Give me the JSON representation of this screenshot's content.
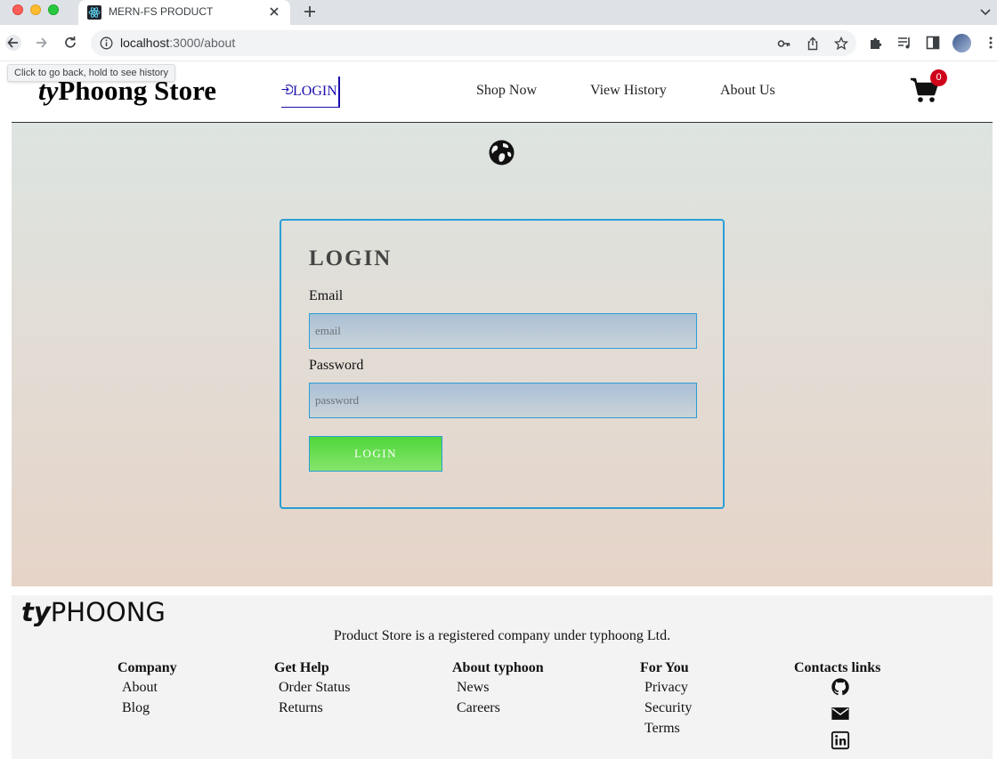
{
  "browser": {
    "tab_title": "MERN-FS PRODUCT",
    "url_host": "localhost",
    "url_path": ":3000/about",
    "tooltip": "Click to go back, hold to see history"
  },
  "header": {
    "brand_prefix": "ty",
    "brand_rest": "Phoong Store",
    "login_label": "LOGIN",
    "nav": [
      "Shop Now",
      "View History",
      "About Us"
    ],
    "cart_count": "0"
  },
  "login_form": {
    "title": "LOGIN",
    "email_label": "Email",
    "email_placeholder": "email",
    "email_value": "",
    "password_label": "Password",
    "password_placeholder": "password",
    "password_value": "",
    "submit_label": "LOGIN"
  },
  "footer": {
    "logo_prefix": "ty",
    "logo_rest": "PHOONG",
    "tagline": "Product Store is a registered company under typhoong Ltd.",
    "columns": [
      {
        "title": "Company",
        "links": [
          "About",
          "Blog"
        ]
      },
      {
        "title": "Get Help",
        "links": [
          "Order Status",
          "Returns"
        ]
      },
      {
        "title": "About typhoon",
        "links": [
          "News",
          "Careers"
        ]
      },
      {
        "title": "For You",
        "links": [
          "Privacy",
          "Security",
          "Terms"
        ]
      }
    ],
    "contacts_title": "Contacts links",
    "contacts_icons": [
      "github-icon",
      "mail-icon",
      "linkedin-icon"
    ]
  },
  "colors": {
    "accent_border": "#2a9ed6",
    "button_green": "#4ed73a",
    "cart_badge": "#d0021b",
    "link": "#1a0dab"
  }
}
